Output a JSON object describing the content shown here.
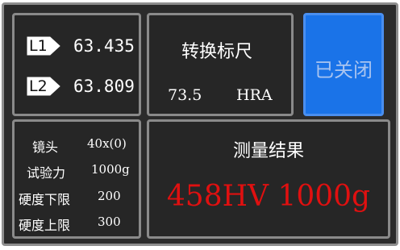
{
  "readings": [
    {
      "tag": "L1",
      "value": "63.435"
    },
    {
      "tag": "L2",
      "value": "63.809"
    }
  ],
  "conversion": {
    "title": "转换标尺",
    "value": "73.5",
    "unit": "HRA"
  },
  "closed_button": {
    "label": "已关闭"
  },
  "params": [
    {
      "label": "镜头",
      "value": "40x(0)"
    },
    {
      "label": "试验力",
      "value": "1000g"
    },
    {
      "label": "硬度下限",
      "value": "200"
    },
    {
      "label": "硬度上限",
      "value": "300"
    }
  ],
  "result": {
    "title": "测量结果",
    "value": "458HV 1000g"
  },
  "colors": {
    "accent": "#1a73e8",
    "result": "#e01010",
    "panel": "#262626"
  }
}
